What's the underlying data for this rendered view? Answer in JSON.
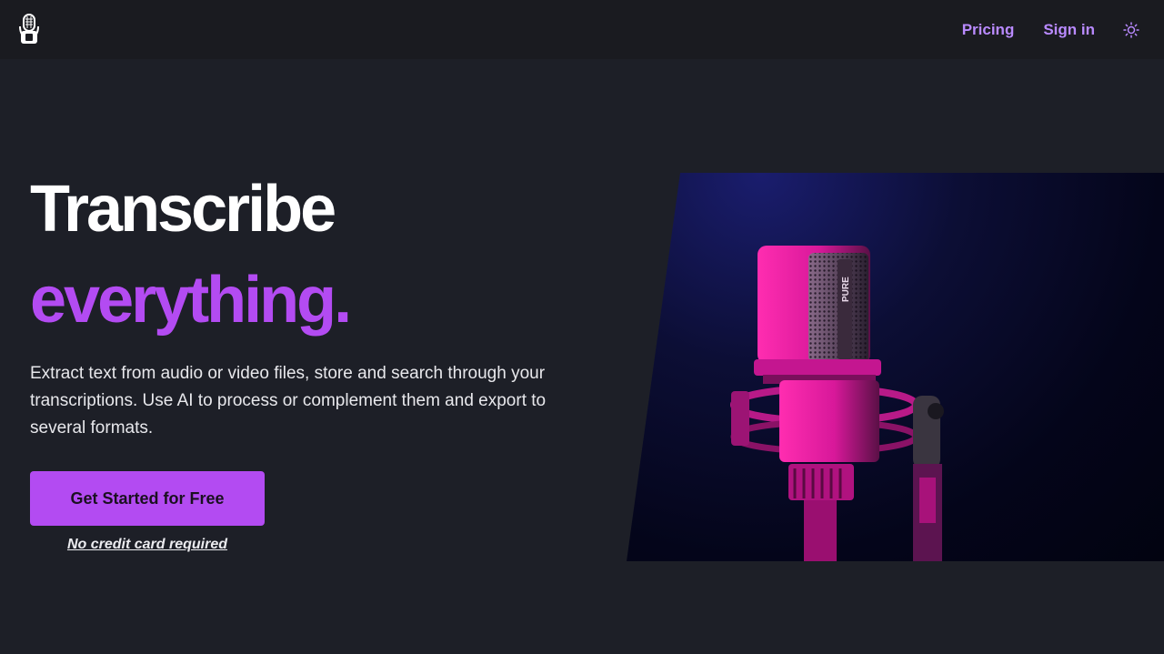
{
  "navbar": {
    "logo_icon": "microphone-icon",
    "links": [
      {
        "label": "Pricing"
      },
      {
        "label": "Sign in"
      }
    ],
    "theme_toggle_icon": "sun-icon"
  },
  "hero": {
    "title_line1": "Transcribe",
    "title_line2": "everything.",
    "description": "Extract text from audio or video files, store and search through your transcriptions. Use AI to process or complement them and export to several formats.",
    "cta_label": "Get Started for Free",
    "cta_note": "No credit card required",
    "image": {
      "subject": "microphone-photo",
      "mic_label": "PURE"
    }
  },
  "colors": {
    "accent": "#b34bf2",
    "link": "#b98aff",
    "background": "#1d1f27",
    "navbar": "#1a1b20"
  }
}
